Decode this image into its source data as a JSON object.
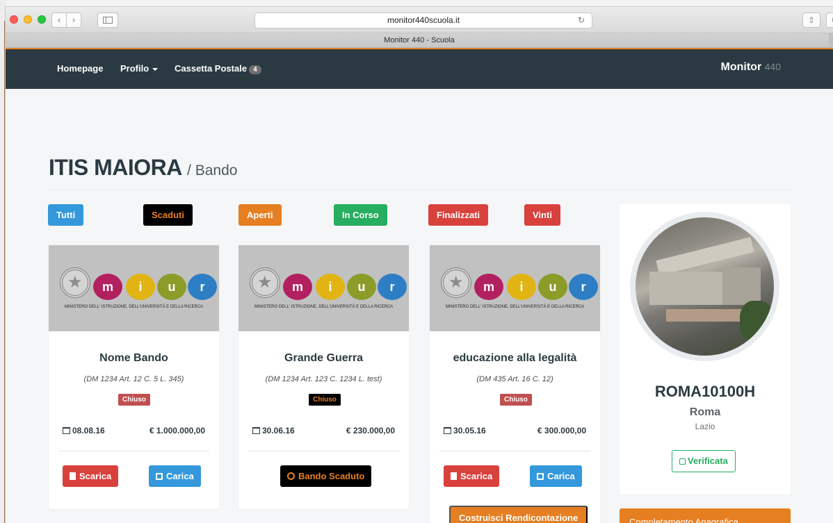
{
  "browser": {
    "url": "monitor440scuola.it",
    "tab_title": "Monitor 440 - Scuola",
    "back": "‹",
    "forward": "›",
    "reload": "↻",
    "share": "⇧",
    "tabs": "⧉"
  },
  "navbar": {
    "home": "Homepage",
    "profile": "Profilo",
    "mailbox": "Cassetta Postale",
    "mailbox_count": "4",
    "brand": "Monitor",
    "brand_num": "440"
  },
  "page": {
    "title": "ITIS MAIORA",
    "subtitle": "/ Bando"
  },
  "filters": {
    "tutti": "Tutti",
    "scaduti": "Scaduti",
    "aperti": "Aperti",
    "in_corso": "In Corso",
    "finalizzati": "Finalizzati",
    "vinti": "Vinti"
  },
  "logo": {
    "m": "m",
    "i": "i",
    "u": "u",
    "r": "r",
    "caption": "MINISTERO DELL' ISTRUZIONE, DELL'UNIVERSITÀ E DELLA RICERCA"
  },
  "cards": [
    {
      "title": "Nome Bando",
      "ref": "(DM 1234 Art. 12 C. 5 L. 345)",
      "status": "Chiuso",
      "date": "08.08.16",
      "amount": "€  1.000.000,00",
      "btn_download": "Scarica",
      "btn_upload": "Carica"
    },
    {
      "title": "Grande Guerra",
      "ref": "(DM 1234 Art. 123 C. 1234 L. test)",
      "status": "Chiuso",
      "date": "30.06.16",
      "amount": "€  230.000,00",
      "btn_expired": "Bando Scaduto"
    },
    {
      "title": "educazione alla legalità",
      "ref": "(DM 435 Art. 16 C. 12)",
      "status": "Chiuso",
      "date": "30.05.16",
      "amount": "€  300.000,00",
      "btn_download": "Scarica",
      "btn_upload": "Carica",
      "btn_report": "Costruisci Rendicontazione"
    }
  ],
  "school": {
    "code": "ROMA10100H",
    "city": "Roma",
    "region": "Lazio",
    "verified": "Verificata"
  },
  "anagrafica": {
    "title": "Completamento Anagrafica"
  },
  "colors": {
    "navbar": "#2b3a42",
    "accent": "#e67e22",
    "blue": "#3498db",
    "green": "#27ae60",
    "red": "#d9413d"
  }
}
